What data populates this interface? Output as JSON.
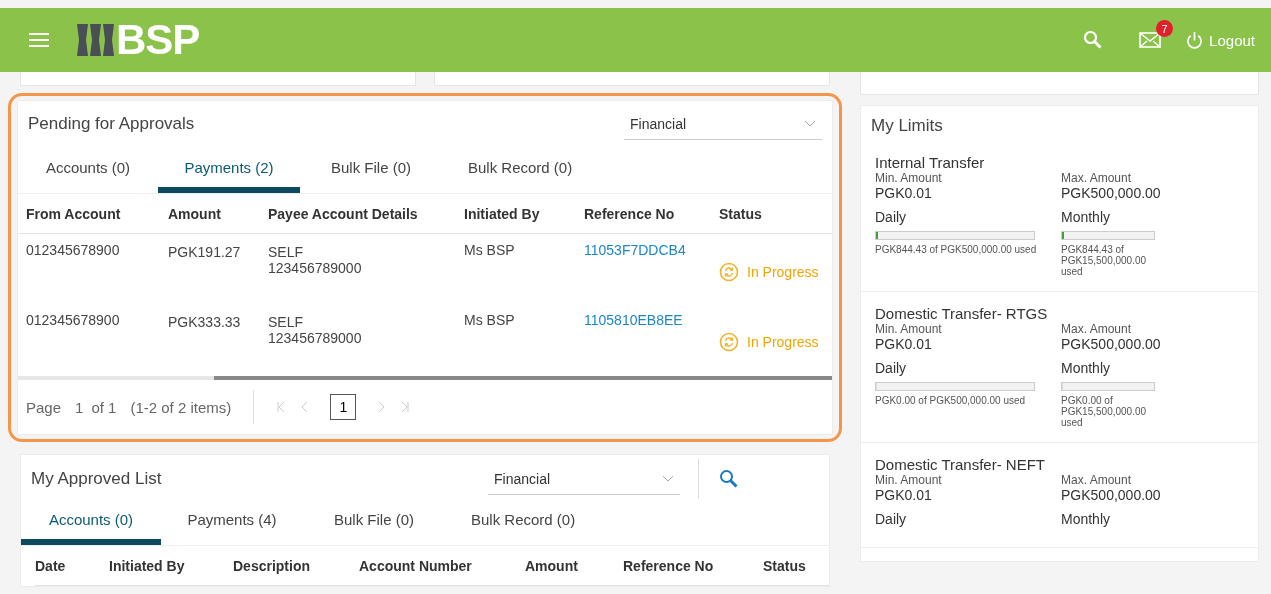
{
  "header": {
    "brand": "BSP",
    "notifications": "7",
    "logout": "Logout"
  },
  "pending": {
    "title": "Pending for Approvals",
    "filter": "Financial",
    "highlighted": true,
    "tabs": [
      {
        "label": "Accounts (0)",
        "selected": false
      },
      {
        "label": "Payments (2)",
        "selected": true
      },
      {
        "label": "Bulk File (0)",
        "selected": false
      },
      {
        "label": "Bulk Record (0)",
        "selected": false
      }
    ],
    "columns": [
      "From Account",
      "Amount",
      "Payee Account Details",
      "Initiated By",
      "Reference No",
      "Status"
    ],
    "rows": [
      {
        "from": "012345678900",
        "amount": "PGK191.27",
        "payee": "SELF",
        "payee_account": "123456789000",
        "initiated_by": "Ms BSP",
        "reference": "11053F7DDCB4",
        "status": "In Progress"
      },
      {
        "from": "012345678900",
        "amount": "PGK333.33",
        "payee": "SELF",
        "payee_account": "123456789000",
        "initiated_by": "Ms BSP",
        "reference": "1105810EB8EE",
        "status": "In Progress"
      }
    ],
    "pager": {
      "page_label": "Page",
      "page": "1",
      "of": "of 1",
      "items": "(1-2 of 2 items)",
      "current": "1"
    }
  },
  "approved": {
    "title": "My Approved List",
    "filter": "Financial",
    "tabs": [
      {
        "label": "Accounts (0)",
        "selected": true
      },
      {
        "label": "Payments (4)",
        "selected": false
      },
      {
        "label": "Bulk File (0)",
        "selected": false
      },
      {
        "label": "Bulk Record (0)",
        "selected": false
      }
    ],
    "columns": [
      "Date",
      "Initiated By",
      "Description",
      "Account Number",
      "Amount",
      "Reference No",
      "Status"
    ]
  },
  "limits": {
    "title": "My Limits",
    "items": [
      {
        "name": "Internal Transfer",
        "min_label": "Min. Amount",
        "min": "PGK0.01",
        "max_label": "Max. Amount",
        "max": "PGK500,000.00",
        "daily_label": "Daily",
        "monthly_label": "Monthly",
        "daily": {
          "level": 0.0017,
          "used": "PGK844.43 of PGK500,000.00 used"
        },
        "monthly": {
          "level": 0.0001,
          "used": "PGK844.43 of PGK15,500,000.00 used"
        }
      },
      {
        "name": "Domestic Transfer- RTGS",
        "min_label": "Min. Amount",
        "min": "PGK0.01",
        "max_label": "Max. Amount",
        "max": "PGK500,000.00",
        "daily_label": "Daily",
        "monthly_label": "Monthly",
        "daily": {
          "level": 0,
          "used": "PGK0.00 of PGK500,000.00 used"
        },
        "monthly": {
          "level": 0,
          "used": "PGK0.00 of PGK15,500,000.00 used"
        }
      },
      {
        "name": "Domestic Transfer- NEFT",
        "min_label": "Min. Amount",
        "min": "PGK0.01",
        "max_label": "Max. Amount",
        "max": "PGK500,000.00",
        "daily_label": "Daily",
        "monthly_label": "Monthly"
      }
    ]
  }
}
